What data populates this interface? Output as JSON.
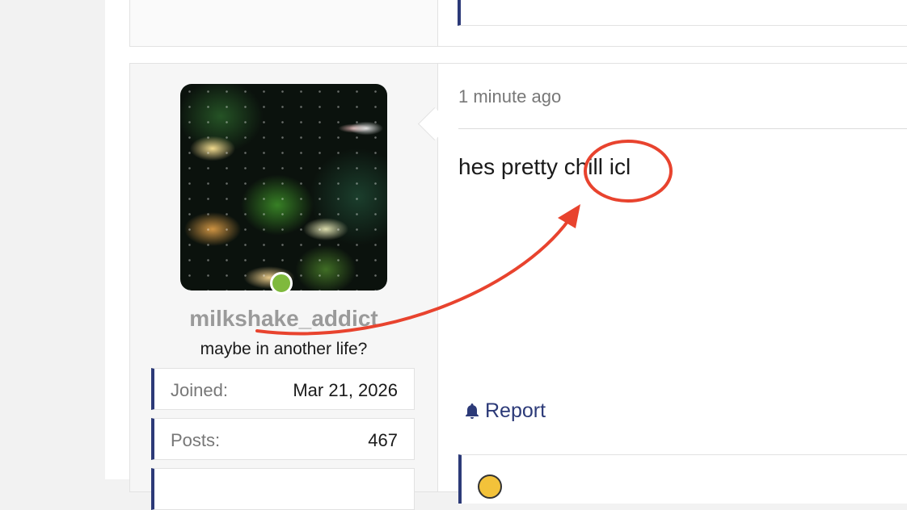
{
  "post": {
    "author": {
      "username": "milkshake_addict",
      "tagline": "maybe in another life?",
      "online": true
    },
    "stats": [
      {
        "label": "Joined:",
        "value": "Mar 21, 2026"
      },
      {
        "label": "Posts:",
        "value": "467"
      },
      {
        "label": "",
        "value": ""
      }
    ],
    "timestamp": "1 minute ago",
    "body": "hes pretty chill icl",
    "report_label": "Report"
  },
  "icons": {
    "report": "bell-icon",
    "status": "online-dot"
  },
  "colors": {
    "accent": "#2c3a78",
    "online": "#7fb93d",
    "annotation": "#e8432e"
  }
}
